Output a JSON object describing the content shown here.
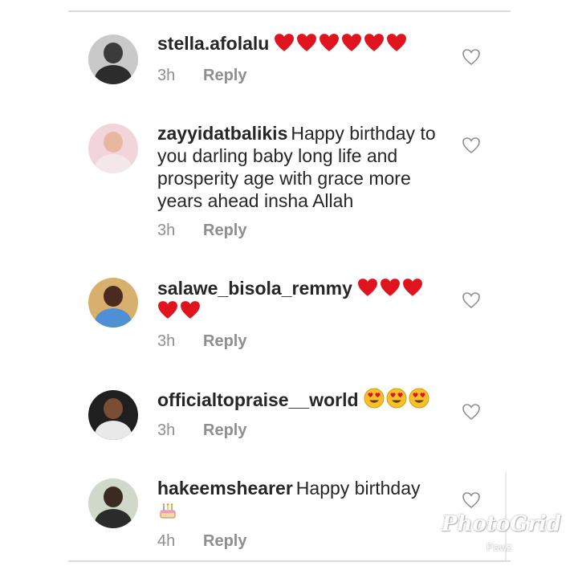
{
  "comments": [
    {
      "username": "stella.afolalu",
      "body": "",
      "hearts_line1": 6,
      "hearts_line2": 0,
      "emojis": 0,
      "time": "3h",
      "reply_label": "Reply"
    },
    {
      "username": "zayyidatbalikis",
      "body": "Happy birthday to you darling baby long life and prosperity age with grace more years ahead insha Allah",
      "time": "3h",
      "reply_label": "Reply"
    },
    {
      "username": "salawe_bisola_remmy",
      "body": "",
      "hearts_line1": 3,
      "hearts_line2": 2,
      "time": "3h",
      "reply_label": "Reply"
    },
    {
      "username": "officialtopraise__world",
      "body": "",
      "emojis": 3,
      "time": "3h",
      "reply_label": "Reply"
    },
    {
      "username": "hakeemshearer",
      "body": "Happy birthday",
      "time": "4h",
      "reply_label": "Reply"
    }
  ],
  "icons": {
    "heart_emoji": "red-heart-icon",
    "heart_eyes_emoji": "heart-eyes-emoji-icon",
    "cake_emoji": "birthday-cake-icon",
    "like": "heart-outline-icon"
  },
  "colors": {
    "username": "#262626",
    "meta": "#8e8e8e",
    "heart": "#e0141e",
    "divider": "#dbdbdb"
  },
  "watermark": {
    "brand": "PhotoGrid",
    "sub": "Pawz"
  }
}
